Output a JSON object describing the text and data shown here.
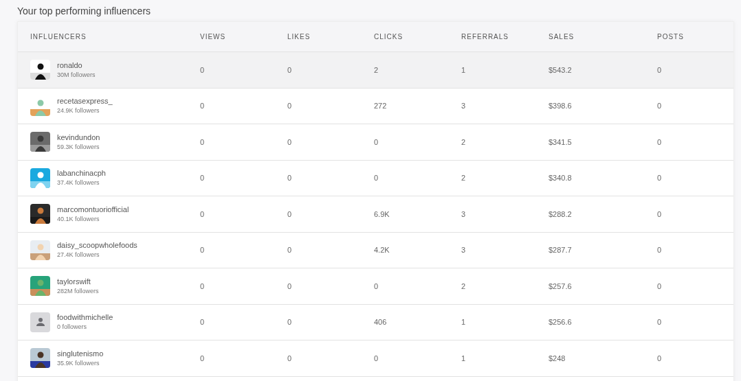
{
  "title": "Your top performing influencers",
  "table": {
    "columns": [
      "INFLUENCERS",
      "VIEWS",
      "LIKES",
      "CLICKS",
      "REFERRALS",
      "SALES",
      "POSTS"
    ],
    "rows": [
      {
        "name": "ronaldo",
        "followers": "30M followers",
        "highlighted": true,
        "views": "0",
        "likes": "0",
        "clicks": "2",
        "referrals": "1",
        "sales": "$543.2",
        "posts": "0"
      },
      {
        "name": "recetasexpress_",
        "followers": "24.9K followers",
        "highlighted": false,
        "views": "0",
        "likes": "0",
        "clicks": "272",
        "referrals": "3",
        "sales": "$398.6",
        "posts": "0"
      },
      {
        "name": "kevindundon",
        "followers": "59.3K followers",
        "highlighted": false,
        "views": "0",
        "likes": "0",
        "clicks": "0",
        "referrals": "2",
        "sales": "$341.5",
        "posts": "0"
      },
      {
        "name": "labanchinacph",
        "followers": "37.4K followers",
        "highlighted": false,
        "views": "0",
        "likes": "0",
        "clicks": "0",
        "referrals": "2",
        "sales": "$340.8",
        "posts": "0"
      },
      {
        "name": "marcomontuoriofficial",
        "followers": "40.1K followers",
        "highlighted": false,
        "views": "0",
        "likes": "0",
        "clicks": "6.9K",
        "referrals": "3",
        "sales": "$288.2",
        "posts": "0"
      },
      {
        "name": "daisy_scoopwholefoods",
        "followers": "27.4K followers",
        "highlighted": false,
        "views": "0",
        "likes": "0",
        "clicks": "4.2K",
        "referrals": "3",
        "sales": "$287.7",
        "posts": "0"
      },
      {
        "name": "taylorswift",
        "followers": "282M followers",
        "highlighted": false,
        "views": "0",
        "likes": "0",
        "clicks": "0",
        "referrals": "2",
        "sales": "$257.6",
        "posts": "0"
      },
      {
        "name": "foodwithmichelle",
        "followers": "0 followers",
        "avatar": {
          "kind": "default"
        },
        "highlighted": false,
        "views": "0",
        "likes": "0",
        "clicks": "406",
        "referrals": "1",
        "sales": "$256.6",
        "posts": "0"
      },
      {
        "name": "singlutenismo",
        "followers": "35.9K followers",
        "highlighted": false,
        "views": "0",
        "likes": "0",
        "clicks": "0",
        "referrals": "1",
        "sales": "$248",
        "posts": "0"
      }
    ]
  }
}
